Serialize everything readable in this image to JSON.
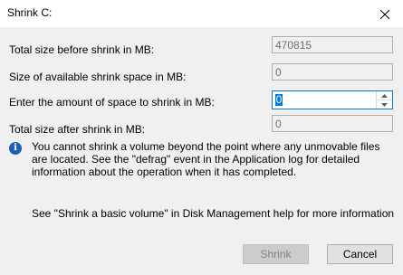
{
  "window": {
    "title": "Shrink C:",
    "close_icon": "close-icon"
  },
  "fields": {
    "total_size_before": {
      "label": "Total size before shrink in MB:",
      "value": "470815"
    },
    "available_shrink": {
      "label": "Size of available shrink space in MB:",
      "value": "0"
    },
    "amount_to_shrink": {
      "label": "Enter the amount of space to shrink in MB:",
      "value": "0"
    },
    "total_size_after": {
      "label": "Total size after shrink in MB:",
      "value": "0"
    }
  },
  "info": {
    "icon": "info-icon",
    "text": "You cannot shrink a volume beyond the point where any unmovable files are located. See the \"defrag\" event in the Application log for detailed information about the operation when it has completed."
  },
  "help": {
    "text": "See \"Shrink a basic volume\" in Disk Management help for more information"
  },
  "buttons": {
    "shrink": "Shrink",
    "cancel": "Cancel"
  },
  "colors": {
    "accent": "#0078d7",
    "dialog_bg": "#f0f0f0",
    "info_icon": "#1e5fb4"
  }
}
